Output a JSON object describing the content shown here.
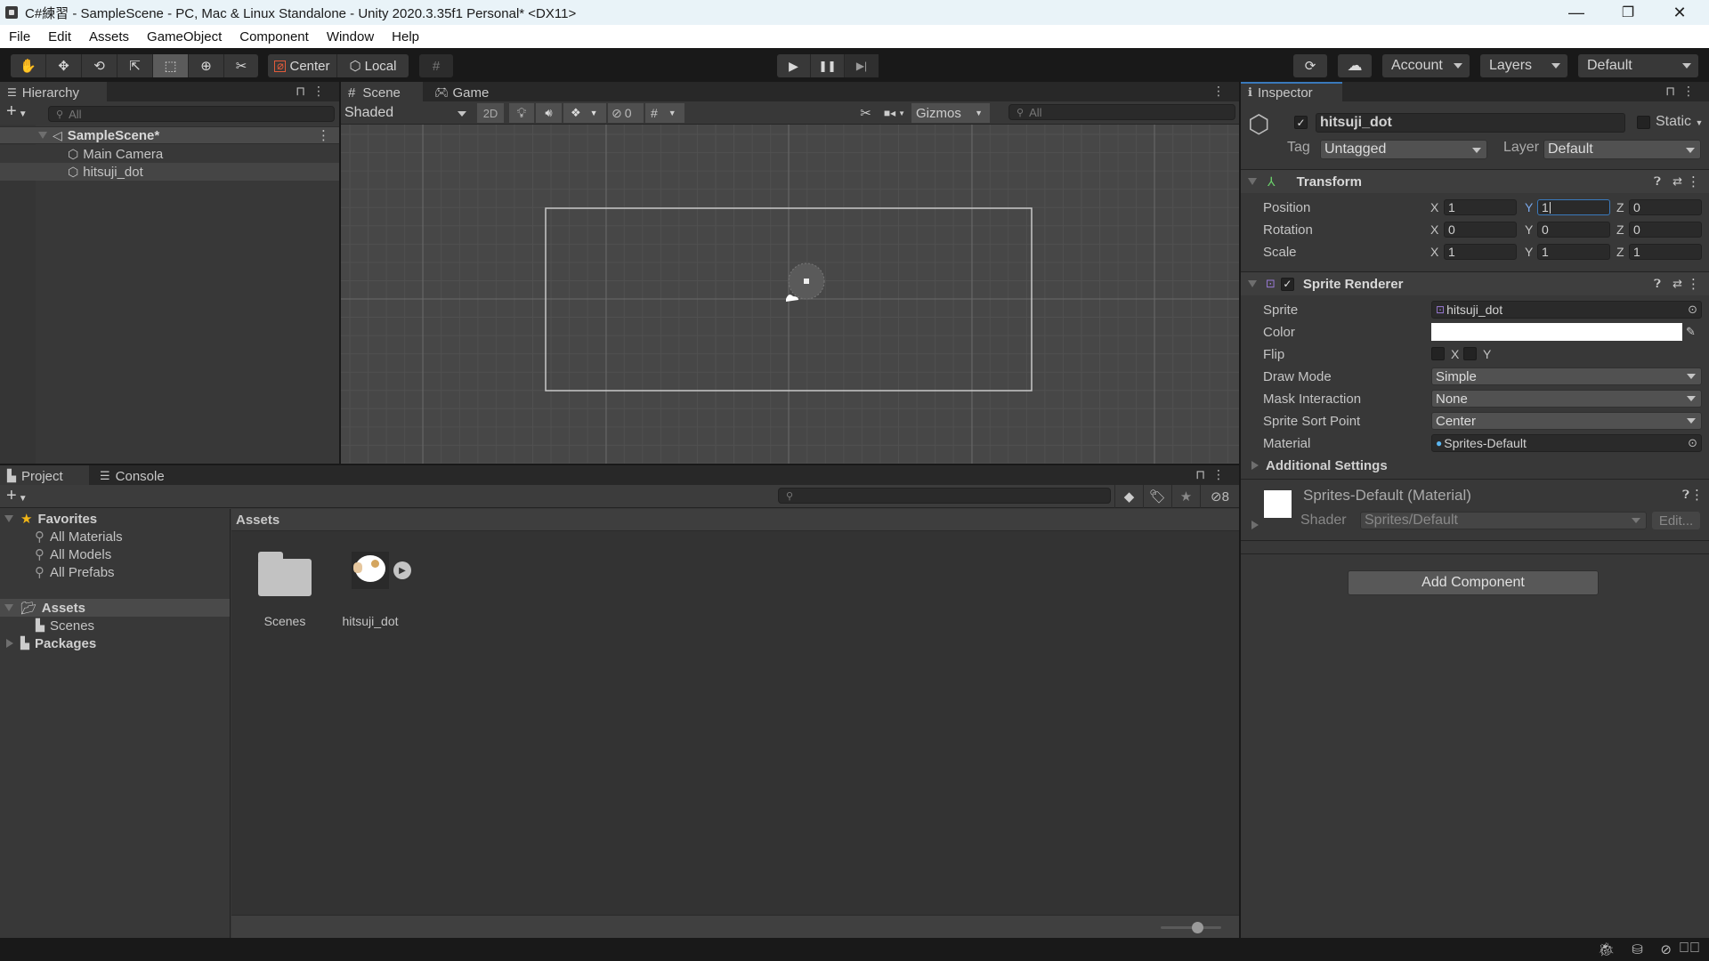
{
  "window": {
    "title": "C#練習 - SampleScene - PC, Mac & Linux Standalone - Unity 2020.3.35f1 Personal* <DX11>",
    "controls": {
      "minimize": "—",
      "maximize": "❐",
      "close": "✕"
    }
  },
  "menubar": [
    "File",
    "Edit",
    "Assets",
    "GameObject",
    "Component",
    "Window",
    "Help"
  ],
  "toolbar": {
    "tools": [
      {
        "name": "hand-tool",
        "icon": "✋"
      },
      {
        "name": "move-tool",
        "icon": "✥"
      },
      {
        "name": "rotate-tool",
        "icon": "⟲"
      },
      {
        "name": "scale-tool",
        "icon": "⇱"
      },
      {
        "name": "rect-tool",
        "icon": "⬚",
        "active": true
      },
      {
        "name": "transform-tool",
        "icon": "⊕"
      },
      {
        "name": "custom-tool",
        "icon": "✂"
      }
    ],
    "pivot_mode": "Center",
    "pivot_rotation": "Local",
    "grid_snap_icon": "#",
    "play": "▶",
    "pause": "❚❚",
    "step": "▶|",
    "collab_icon": "⟳",
    "cloud_icon": "☁",
    "account": "Account",
    "layers": "Layers",
    "layout": "Default"
  },
  "hierarchy": {
    "tab": "Hierarchy",
    "search_placeholder": "All",
    "scene": "SampleScene*",
    "items": [
      "Main Camera",
      "hitsuji_dot"
    ],
    "selected": "hitsuji_dot"
  },
  "scene_view": {
    "tabs": [
      "Scene",
      "Game"
    ],
    "shading": "Shaded",
    "mode_2d": "2D",
    "hidden_count": "0",
    "gizmos": "Gizmos",
    "search_placeholder": "All"
  },
  "project": {
    "tabs": [
      "Project",
      "Console"
    ],
    "favorites_label": "Favorites",
    "favorites": [
      "All Materials",
      "All Models",
      "All Prefabs"
    ],
    "tree": {
      "assets": "Assets",
      "children": [
        "Scenes"
      ],
      "packages": "Packages"
    },
    "breadcrumb": "Assets",
    "items": [
      {
        "name": "Scenes",
        "type": "folder"
      },
      {
        "name": "hitsuji_dot",
        "type": "sprite"
      }
    ],
    "hidden_packages_count": "8",
    "zoom_slider": 0.6
  },
  "inspector": {
    "tab": "Inspector",
    "object_name": "hitsuji_dot",
    "active": true,
    "static_label": "Static",
    "tag_label": "Tag",
    "tag": "Untagged",
    "layer_label": "Layer",
    "layer": "Default",
    "transform": {
      "title": "Transform",
      "rows": [
        {
          "label": "Position",
          "x": "1",
          "y": "1",
          "z": "0"
        },
        {
          "label": "Rotation",
          "x": "0",
          "y": "0",
          "z": "0"
        },
        {
          "label": "Scale",
          "x": "1",
          "y": "1",
          "z": "1"
        }
      ]
    },
    "sprite_renderer": {
      "title": "Sprite Renderer",
      "enabled": true,
      "sprite_label": "Sprite",
      "sprite": "hitsuji_dot",
      "color_label": "Color",
      "color": "#ffffff",
      "flip_label": "Flip",
      "flip_x": "X",
      "flip_y": "Y",
      "draw_mode_label": "Draw Mode",
      "draw_mode": "Simple",
      "mask_label": "Mask Interaction",
      "mask": "None",
      "sort_label": "Sprite Sort Point",
      "sort": "Center",
      "material_label": "Material",
      "material": "Sprites-Default",
      "additional": "Additional Settings"
    },
    "material": {
      "title": "Sprites-Default (Material)",
      "shader_label": "Shader",
      "shader": "Sprites/Default",
      "edit": "Edit..."
    },
    "add_component": "Add Component"
  },
  "colors": {
    "accent_blue": "#3a79bb",
    "sprite_icon": "#9b7bd8",
    "material_icon": "#5ab5ef",
    "favorites_star": "#f2b616"
  }
}
